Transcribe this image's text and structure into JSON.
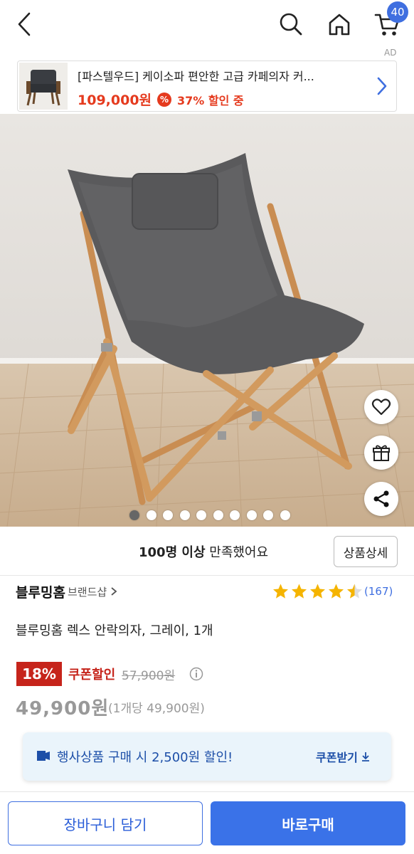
{
  "header": {
    "cart_count": "40"
  },
  "ad": {
    "label": "AD",
    "title": "[파스텔우드] 케이소파 편안한 고급 카페의자 커...",
    "price": "109,000원",
    "discount_icon": "%",
    "discount_text": "37% 할인 중"
  },
  "carousel": {
    "total": 10,
    "active_index": 0
  },
  "satisfaction": {
    "bold": "100명 이상",
    "rest": " 만족했어요",
    "detail_button": "상품상세"
  },
  "product": {
    "brand": "블루밍홈",
    "brand_shop": "브랜드샵",
    "rating": 4.5,
    "review_count": "(167)",
    "title": "블루밍홈 렉스 안락의자, 그레이, 1개",
    "discount_pct": "18%",
    "coupon_label": "쿠폰할인",
    "original_price": "57,900원",
    "sale_price": "49,900원",
    "unit_price": "(1개당 49,900원)"
  },
  "coupon_toast": {
    "text": "행사상품 구매 시 2,500원 할인!",
    "button": "쿠폰받기"
  },
  "bottom_bar": {
    "cart_button": "장바구니 담기",
    "buy_button": "바로구매"
  },
  "colors": {
    "accent_blue": "#3a72e8",
    "sale_red": "#c6241b",
    "ad_red": "#e53a1e",
    "star": "#f5b400"
  }
}
